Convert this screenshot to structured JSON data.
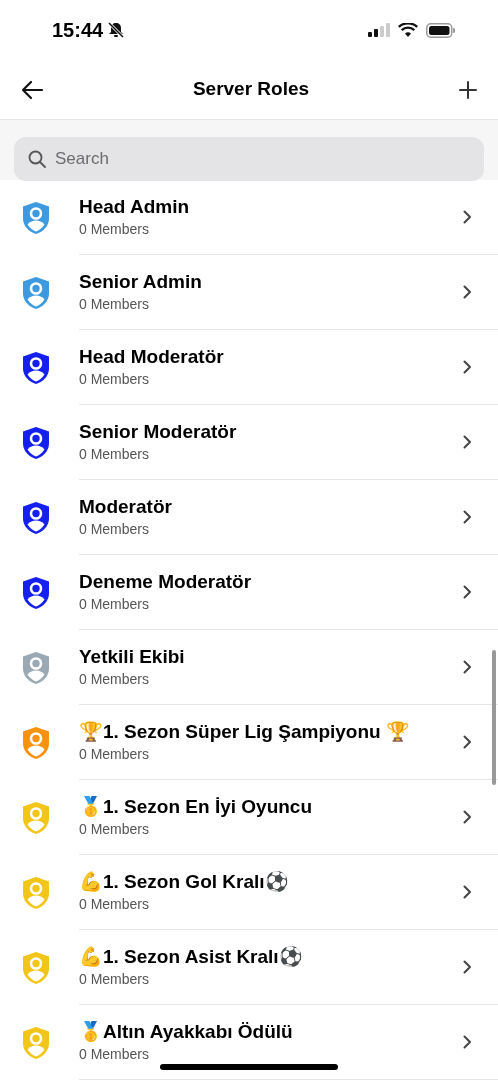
{
  "status_bar": {
    "time": "15:44"
  },
  "header": {
    "title": "Server Roles"
  },
  "search": {
    "placeholder": "Search"
  },
  "roles": [
    {
      "name": "Head Admin",
      "members": "0 Members",
      "color": "#3d9ae0"
    },
    {
      "name": "Senior Admin",
      "members": "0 Members",
      "color": "#3d9ae0"
    },
    {
      "name": "Head Moderatör",
      "members": "0 Members",
      "color": "#1620ee"
    },
    {
      "name": "Senior Moderatör",
      "members": "0 Members",
      "color": "#1620ee"
    },
    {
      "name": "Moderatör",
      "members": "0 Members",
      "color": "#1620ee"
    },
    {
      "name": "Deneme Moderatör",
      "members": "0 Members",
      "color": "#1620ee"
    },
    {
      "name": "Yetkili Ekibi",
      "members": "0 Members",
      "color": "#9aa9b3"
    },
    {
      "name": "🏆1. Sezon Süper Lig Şampiyonu 🏆",
      "members": "0 Members",
      "color": "#f7920f"
    },
    {
      "name": "🥇1. Sezon En İyi Oyuncu",
      "members": "0 Members",
      "color": "#f2c618"
    },
    {
      "name": "💪1. Sezon Gol Kralı⚽",
      "members": "0 Members",
      "color": "#f2c618"
    },
    {
      "name": "💪1. Sezon Asist Kralı⚽",
      "members": "0 Members",
      "color": "#f2c618"
    },
    {
      "name": "🥇Altın Ayakkabı Ödülü",
      "members": "0 Members",
      "color": "#f2c618"
    }
  ]
}
